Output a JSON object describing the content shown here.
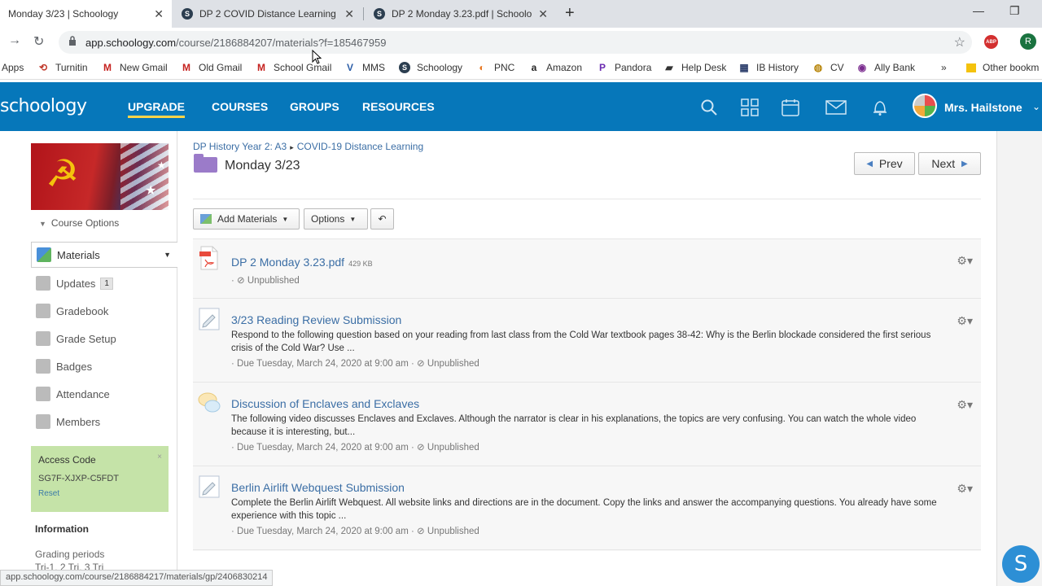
{
  "browser": {
    "tabs": [
      {
        "title": "Monday 3/23 | Schoology",
        "active": true
      },
      {
        "title": "DP 2 COVID Distance Learning Ir",
        "active": false
      },
      {
        "title": "DP 2 Monday 3.23.pdf | Schoolog",
        "active": false
      }
    ],
    "url_host": "app.schoology.com",
    "url_path": "/course/2186884207/materials?f=185467959",
    "profile_initial": "R",
    "abp_label": "ABP",
    "bookmarks": [
      {
        "label": "Apps",
        "icon": "apps-grid-icon"
      },
      {
        "label": "Turnitin",
        "icon": "turnitin-icon"
      },
      {
        "label": "New Gmail",
        "icon": "gmail-icon"
      },
      {
        "label": "Old Gmail",
        "icon": "gmail-icon"
      },
      {
        "label": "School Gmail",
        "icon": "gmail-icon"
      },
      {
        "label": "MMS",
        "icon": "mms-icon"
      },
      {
        "label": "Schoology",
        "icon": "schoology-icon"
      },
      {
        "label": "PNC",
        "icon": "pnc-icon"
      },
      {
        "label": "Amazon",
        "icon": "amazon-icon"
      },
      {
        "label": "Pandora",
        "icon": "pandora-icon"
      },
      {
        "label": "Help Desk",
        "icon": "helpdesk-icon"
      },
      {
        "label": "IB History",
        "icon": "ib-history-icon"
      },
      {
        "label": "CV",
        "icon": "cv-icon"
      },
      {
        "label": "Ally Bank",
        "icon": "ally-icon"
      }
    ],
    "bookmarks_overflow": "»",
    "other_bookmarks": "Other bookm",
    "status_url": "app.schoology.com/course/2186884217/materials/gp/2406830214"
  },
  "header": {
    "logo": "schoology",
    "nav": [
      "UPGRADE",
      "COURSES",
      "GROUPS",
      "RESOURCES"
    ],
    "user_name": "Mrs. Hailstone",
    "brand_color": "#0677ba"
  },
  "sidebar": {
    "course_options": "Course Options",
    "items": [
      {
        "label": "Materials",
        "active": true
      },
      {
        "label": "Updates",
        "badge": "1"
      },
      {
        "label": "Gradebook"
      },
      {
        "label": "Grade Setup"
      },
      {
        "label": "Badges"
      },
      {
        "label": "Attendance"
      },
      {
        "label": "Members"
      }
    ],
    "access_code": {
      "title": "Access Code",
      "code": "SG7F-XJXP-C5FDT",
      "reset": "Reset",
      "close": "×"
    },
    "information": {
      "title": "Information",
      "line1": "Grading periods",
      "line2": "Tri-1, 2 Tri, 3 Tri"
    }
  },
  "main": {
    "breadcrumb": [
      "DP History Year 2: A3",
      "COVID-19 Distance Learning"
    ],
    "breadcrumb_sep": "▸",
    "title": "Monday 3/23",
    "prev": "Prev",
    "next": "Next",
    "add_materials": "Add Materials",
    "options": "Options",
    "items": [
      {
        "name": "DP 2 Monday 3.23.pdf",
        "size": "429 KB",
        "type": "pdf",
        "desc": "",
        "meta": "Unpublished"
      },
      {
        "name": "3/23 Reading Review Submission",
        "type": "assignment",
        "desc": "Respond to the following question based on your reading from last class from the Cold War textbook pages 38-42: Why is the Berlin blockade considered the first serious crisis of the Cold War? Use ...",
        "due": "Due Tuesday, March 24, 2020 at 9:00 am",
        "meta": "Unpublished"
      },
      {
        "name": "Discussion of Enclaves and Exclaves",
        "type": "discussion",
        "desc": "The following video discusses Enclaves and Exclaves. Although the narrator is clear in his explanations, the topics are very confusing. You can watch the whole video because it is interesting, but...",
        "due": "Due Tuesday, March 24, 2020 at 9:00 am",
        "meta": "Unpublished"
      },
      {
        "name": "Berlin Airlift Webquest Submission",
        "type": "assignment",
        "desc": "Complete the Berlin Airlift Webquest. All website links and directions are in the document. Copy the links and answer the accompanying questions. You already have some experience with this topic ...",
        "due": "Due Tuesday, March 24, 2020 at 9:00 am",
        "meta": "Unpublished"
      }
    ]
  },
  "help_button": "S"
}
